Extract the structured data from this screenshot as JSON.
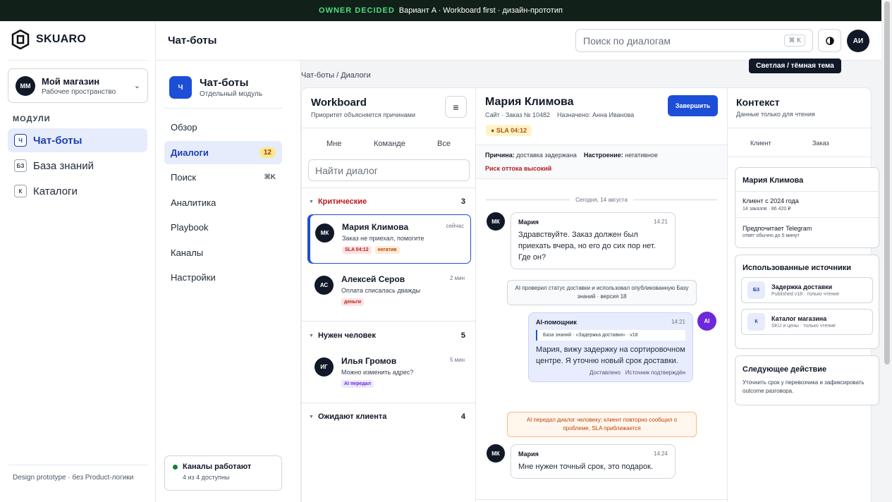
{
  "banner": {
    "tag": "OWNER DECIDED",
    "text": "Вариант A · Workboard first · дизайн-прототип"
  },
  "brand": {
    "name": "SKUARO"
  },
  "workspace": {
    "initials": "ММ",
    "name": "Мой магазин",
    "sub": "Рабочее пространство"
  },
  "modules": {
    "label": "МОДУЛИ",
    "items": [
      {
        "badge": "Ч",
        "label": "Чат-боты"
      },
      {
        "badge": "БЗ",
        "label": "База знаний"
      },
      {
        "badge": "К",
        "label": "Каталоги"
      }
    ]
  },
  "footer_note": "Design prototype · без Product-логики",
  "header": {
    "title": "Чат-боты",
    "search_placeholder": "Поиск по диалогам",
    "search_kbd": "⌘ K",
    "user_initials": "АИ",
    "theme_tooltip": "Светлая / тёмная тема"
  },
  "submenu": {
    "icon": "Ч",
    "title": "Чат-боты",
    "sub": "Отдельный модуль",
    "items": [
      {
        "label": "Обзор"
      },
      {
        "label": "Диалоги",
        "count": "12"
      },
      {
        "label": "Поиск",
        "hotkey": "⌘K"
      },
      {
        "label": "Аналитика"
      },
      {
        "label": "Playbook"
      },
      {
        "label": "Каналы"
      },
      {
        "label": "Настройки"
      }
    ],
    "status": {
      "title": "Каналы работают",
      "sub": "4 из 4 доступны"
    }
  },
  "breadcrumb": "Чат-боты / Диалоги",
  "workboard": {
    "title": "Workboard",
    "sub": "Приоритет объясняется причинами",
    "menu_icon": "≡",
    "tabs": [
      "Мне",
      "Команде",
      "Все"
    ],
    "find_placeholder": "Найти диалог",
    "groups": [
      {
        "name": "Критические",
        "count": "3",
        "color": "#b91c1c"
      },
      {
        "name": "Нужен человек",
        "count": "5",
        "color": "#111827"
      },
      {
        "name": "Ожидают клиента",
        "count": "4",
        "color": "#111827"
      }
    ],
    "conversations": [
      {
        "initials": "МК",
        "name": "Мария Климова",
        "msg": "Заказ не приехал, помогите",
        "time": "сейчас",
        "chips": [
          "SLA 04:12",
          "негатив"
        ]
      },
      {
        "initials": "АС",
        "name": "Алексей Серов",
        "msg": "Оплата списалась дважды",
        "time": "2 мин",
        "chips": [
          "деньги"
        ]
      },
      {
        "initials": "ИГ",
        "name": "Илья Громов",
        "msg": "Можно изменить адрес?",
        "time": "5 мин",
        "chips": [
          "AI передал"
        ]
      }
    ]
  },
  "chat": {
    "name": "Мария Климова",
    "meta": "Сайт · Заказ № 10482    Назначено: Анна Иванова",
    "finish": "Завершить",
    "sla": "● SLA 04:12",
    "reason_label": "Причина:",
    "reason": "доставка задержана",
    "mood_label": "Настроение:",
    "mood": "негативное",
    "risk": "Риск оттока высокий",
    "date": "Сегодня, 14 августа",
    "m1": {
      "initials": "МК",
      "author": "Мария",
      "time": "14:21",
      "text": "Здравствуйте. Заказ должен был приехать вчера, но его до сих пор нет. Где он?"
    },
    "sys1": "AI проверил статус доставки и использовал опубликованную Базу знаний · версия 18",
    "ai": {
      "initials": "AI",
      "author": "AI-помощник",
      "time": "14:21",
      "quote": "База знаний · «Задержка доставки» · v18",
      "text": "Мария, вижу задержку на сортировочном центре. Я уточню новый срок доставки.",
      "foot": "Доставлено   Источник подтверждён"
    },
    "sys2": "AI передал диалог человеку: клиент повторно сообщил о проблеме, SLA приближается",
    "m2": {
      "initials": "МК",
      "author": "Мария",
      "time": "14:24",
      "text": "Мне нужен точный срок, это подарок."
    }
  },
  "context": {
    "title": "Контекст",
    "sub": "Данные только для чтения",
    "tabs": [
      "Клиент",
      "Заказ"
    ],
    "client": {
      "name": "Мария Климова",
      "since": "Клиент с 2024 года",
      "stats": "14 заказов · 86 420 ₽",
      "pref": "Предпочитает Telegram",
      "pref_sub": "ответ обычно до 5 минут"
    },
    "sources": {
      "title": "Использованные источники",
      "items": [
        {
          "icon": "БЗ",
          "name": "Задержка доставки",
          "sub": "Published v18 · только чтение"
        },
        {
          "icon": "К",
          "name": "Каталог магазина",
          "sub": "SKU и цены · только чтение"
        }
      ]
    },
    "next": {
      "title": "Следующее действие",
      "text": "Уточнить срок у перевозчика и зафиксировать outcome разговора."
    }
  }
}
